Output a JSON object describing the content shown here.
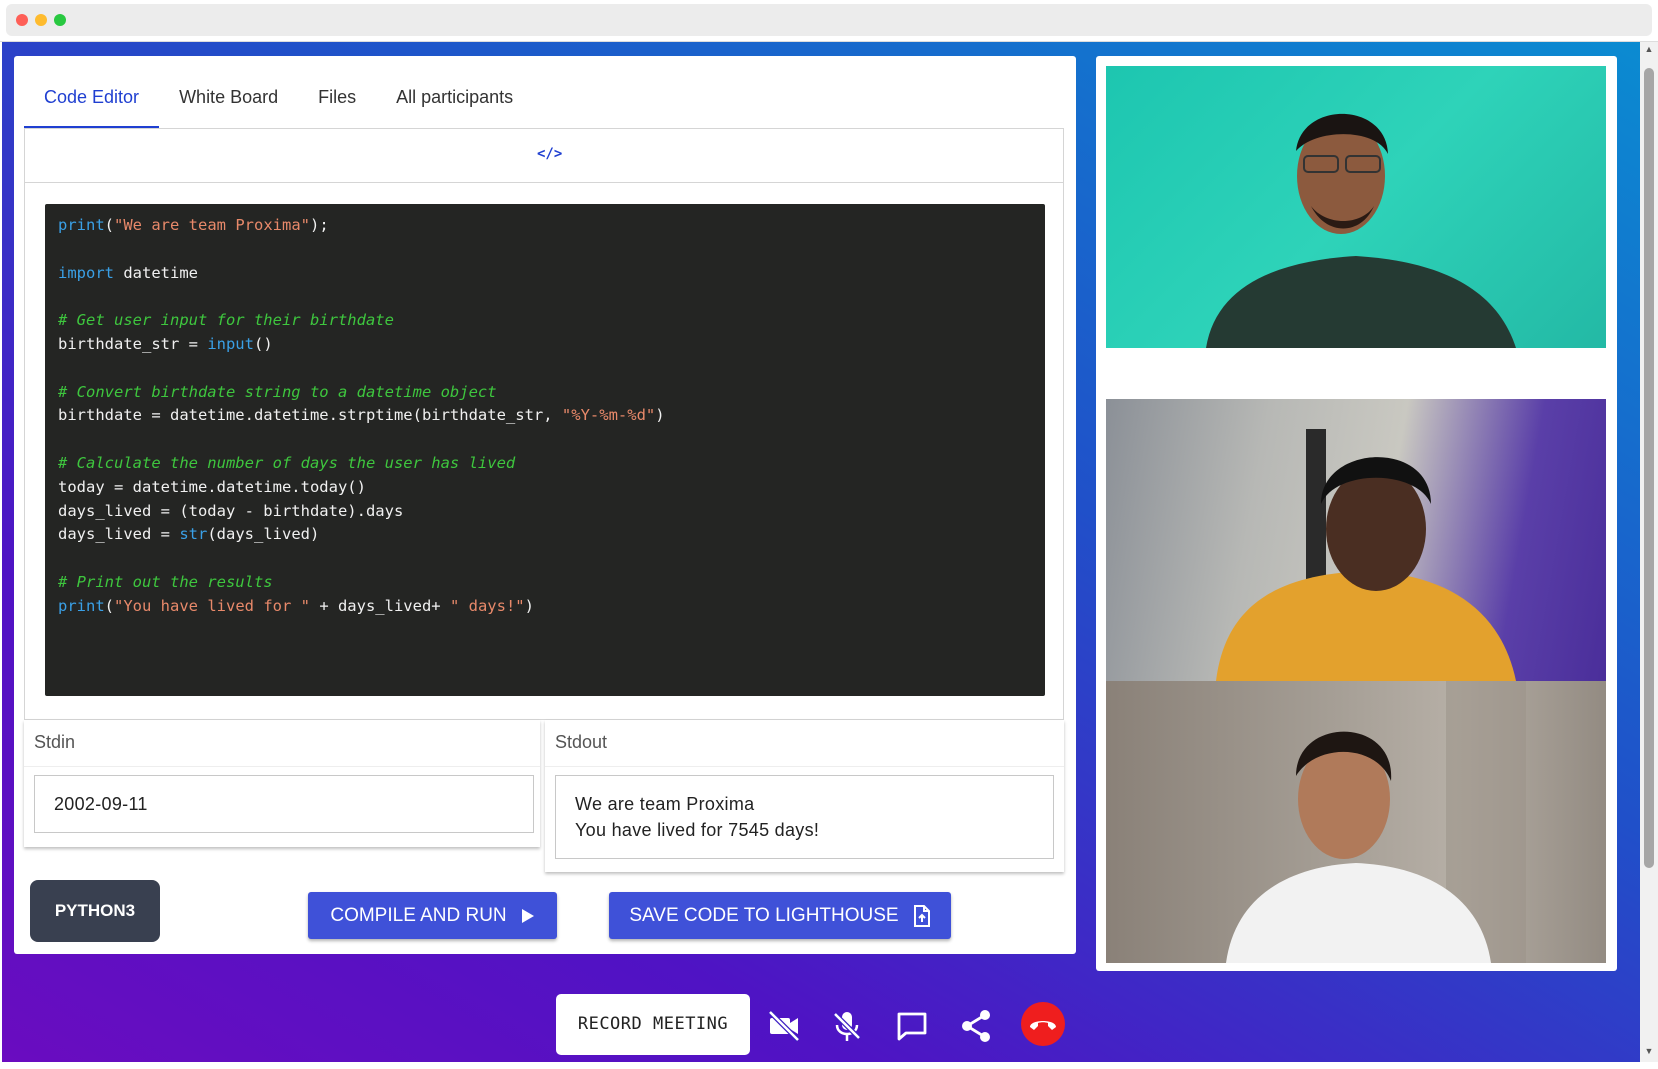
{
  "tabs": [
    {
      "label": "Code Editor",
      "active": true
    },
    {
      "label": "White Board",
      "active": false
    },
    {
      "label": "Files",
      "active": false
    },
    {
      "label": "All participants",
      "active": false
    }
  ],
  "editor": {
    "toggle_label": "</>",
    "code_lines": [
      [
        {
          "t": "print",
          "c": "kw"
        },
        {
          "t": "(",
          "c": ""
        },
        {
          "t": "\"We are team Proxima\"",
          "c": "str"
        },
        {
          "t": ");",
          "c": ""
        }
      ],
      [],
      [
        {
          "t": "import",
          "c": "kw"
        },
        {
          "t": " datetime",
          "c": ""
        }
      ],
      [],
      [
        {
          "t": "# Get user input for their birthdate",
          "c": "cm"
        }
      ],
      [
        {
          "t": "birthdate_str = ",
          "c": ""
        },
        {
          "t": "input",
          "c": "kw"
        },
        {
          "t": "()",
          "c": ""
        }
      ],
      [],
      [
        {
          "t": "# Convert birthdate string to a datetime object",
          "c": "cm"
        }
      ],
      [
        {
          "t": "birthdate = datetime.datetime.strptime(birthdate_str, ",
          "c": ""
        },
        {
          "t": "\"%Y-%m-%d\"",
          "c": "str"
        },
        {
          "t": ")",
          "c": ""
        }
      ],
      [],
      [
        {
          "t": "# Calculate the number of days the user has lived",
          "c": "cm"
        }
      ],
      [
        {
          "t": "today = datetime.datetime.today()",
          "c": ""
        }
      ],
      [
        {
          "t": "days_lived = (today - birthdate).days",
          "c": ""
        }
      ],
      [
        {
          "t": "days_lived = ",
          "c": ""
        },
        {
          "t": "str",
          "c": "kw"
        },
        {
          "t": "(days_lived)",
          "c": ""
        }
      ],
      [],
      [
        {
          "t": "# Print out the results",
          "c": "cm"
        }
      ],
      [
        {
          "t": "print",
          "c": "kw"
        },
        {
          "t": "(",
          "c": ""
        },
        {
          "t": "\"You have lived for \"",
          "c": "str"
        },
        {
          "t": " + days_lived+ ",
          "c": ""
        },
        {
          "t": "\" days!\"",
          "c": "str"
        },
        {
          "t": ")",
          "c": ""
        }
      ]
    ]
  },
  "stdin": {
    "label": "Stdin",
    "value": "2002-09-11"
  },
  "stdout": {
    "label": "Stdout",
    "lines": [
      "We are team Proxima",
      "You have lived for 7545 days!"
    ]
  },
  "buttons": {
    "language": "PYTHON3",
    "compile": "COMPILE AND RUN",
    "save": "SAVE CODE TO LIGHTHOUSE",
    "record": "RECORD MEETING"
  },
  "controls": {
    "icons": [
      "video-off-icon",
      "mic-off-icon",
      "chat-icon",
      "share-icon",
      "end-call-icon"
    ],
    "end_call_color": "#ef1e1e"
  },
  "colors": {
    "accent": "#1f3fd1",
    "button": "#3f51d8",
    "language_button": "#394050",
    "code_bg": "#242523"
  }
}
